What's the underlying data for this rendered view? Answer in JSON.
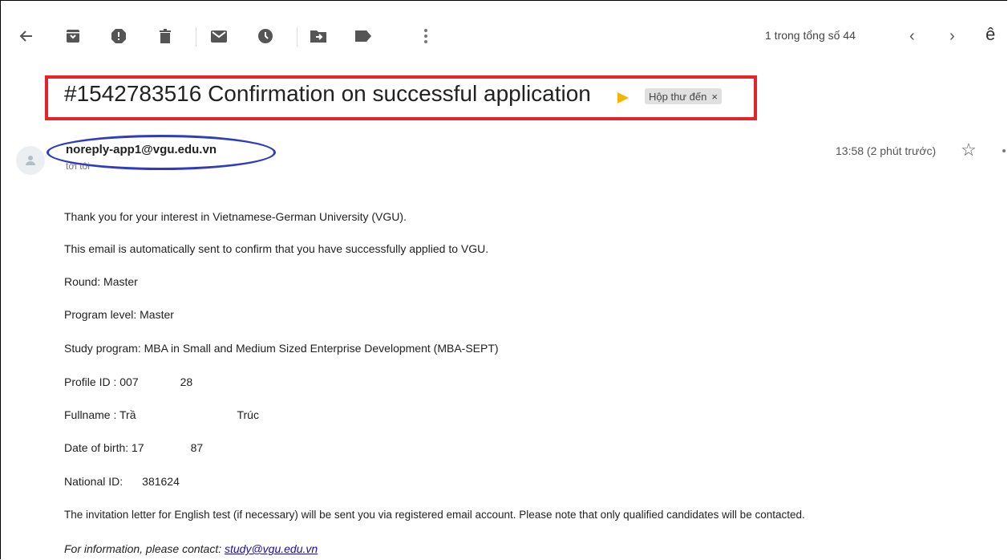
{
  "toolbar": {
    "icons": [
      "back-arrow-icon",
      "archive-icon",
      "report-spam-icon",
      "delete-icon",
      "mark-unread-icon",
      "snooze-icon",
      "move-to-icon",
      "labels-icon",
      "more-vert-icon"
    ],
    "pager_text": "1 trong tổng số 44",
    "prev_label": "‹",
    "next_label": "›",
    "lang_label": "ê"
  },
  "subject": {
    "text": "#1542783516 Confirmation on successful application",
    "label": "Hộp thư đến",
    "label_remove": "×"
  },
  "sender": {
    "email": "noreply-app1@vgu.edu.vn",
    "to": "tới tôi",
    "time": "13:58 (2 phút trước)",
    "star": "☆"
  },
  "body": {
    "line1": "Thank you for your interest in Vietnamese-German University (VGU).",
    "line2": "This email is automatically sent to confirm that you have successfully applied to VGU.",
    "line3": "Round: Master",
    "line4": "Program level: Master",
    "line5": "Study program: MBA in Small and Medium Sized Enterprise Development (MBA-SEPT)",
    "profile_label": "Profile ID : 007",
    "profile_tail": "28",
    "fullname_label": "Fullname : Trầ",
    "fullname_tail": "Trúc",
    "dob_label": "Date of birth: 17",
    "dob_tail": "87",
    "national_label": "National ID:",
    "national_tail": "381624",
    "line10": "The invitation letter for English test (if necessary) will be sent you via registered email account. Please note that only qualified candidates will be contacted.",
    "contact_text": "For information, please contact: ",
    "contact_email": "study@vgu.edu.vn"
  },
  "colors": {
    "highlight_red": "#e5232b",
    "highlight_blue": "#2e3cbd",
    "important_marker": "#f4b400"
  }
}
